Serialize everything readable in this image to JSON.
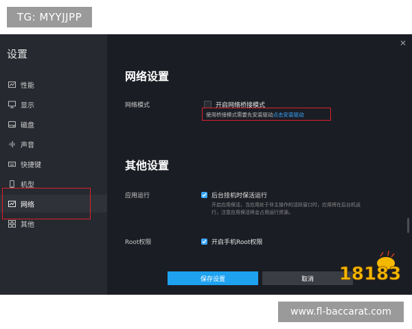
{
  "watermarks": {
    "top": "TG: MYYJJPP",
    "bottom": "www.fl-baccarat.com"
  },
  "sidebar": {
    "title": "设置",
    "items": [
      {
        "label": "性能",
        "icon": "performance-icon"
      },
      {
        "label": "显示",
        "icon": "monitor-icon"
      },
      {
        "label": "磁盘",
        "icon": "disk-icon"
      },
      {
        "label": "声音",
        "icon": "sound-icon"
      },
      {
        "label": "快捷键",
        "icon": "keyboard-icon"
      },
      {
        "label": "机型",
        "icon": "phone-icon"
      },
      {
        "label": "网络",
        "icon": "network-icon"
      },
      {
        "label": "其他",
        "icon": "grid-icon"
      }
    ],
    "active_index": 6
  },
  "network": {
    "title": "网络设置",
    "mode_label": "网络模式",
    "bridge_option": "开启网络桥接模式",
    "bridge_checked": false,
    "hint_text": "使用桥接模式需要先安装驱动",
    "hint_link": "点击安装驱动"
  },
  "other": {
    "title": "其他设置",
    "app_label": "应用运行",
    "keep_alive_option": "后台挂机时保活运行",
    "keep_alive_checked": true,
    "keep_alive_note_1": "开启应用保活，当应用处于非主操作的活跃窗口时，应用将在后台机运",
    "keep_alive_note_2": "行，注意应用保活将会占用运行资源。",
    "root_label": "Root权限",
    "root_option": "开启手机Root权限",
    "root_checked": true
  },
  "buttons": {
    "save": "保存设置",
    "cancel": "取消"
  },
  "logo_text": "18183",
  "colors": {
    "accent": "#1ea2f0",
    "highlight": "#e0202a",
    "logo": "#f5b800"
  }
}
